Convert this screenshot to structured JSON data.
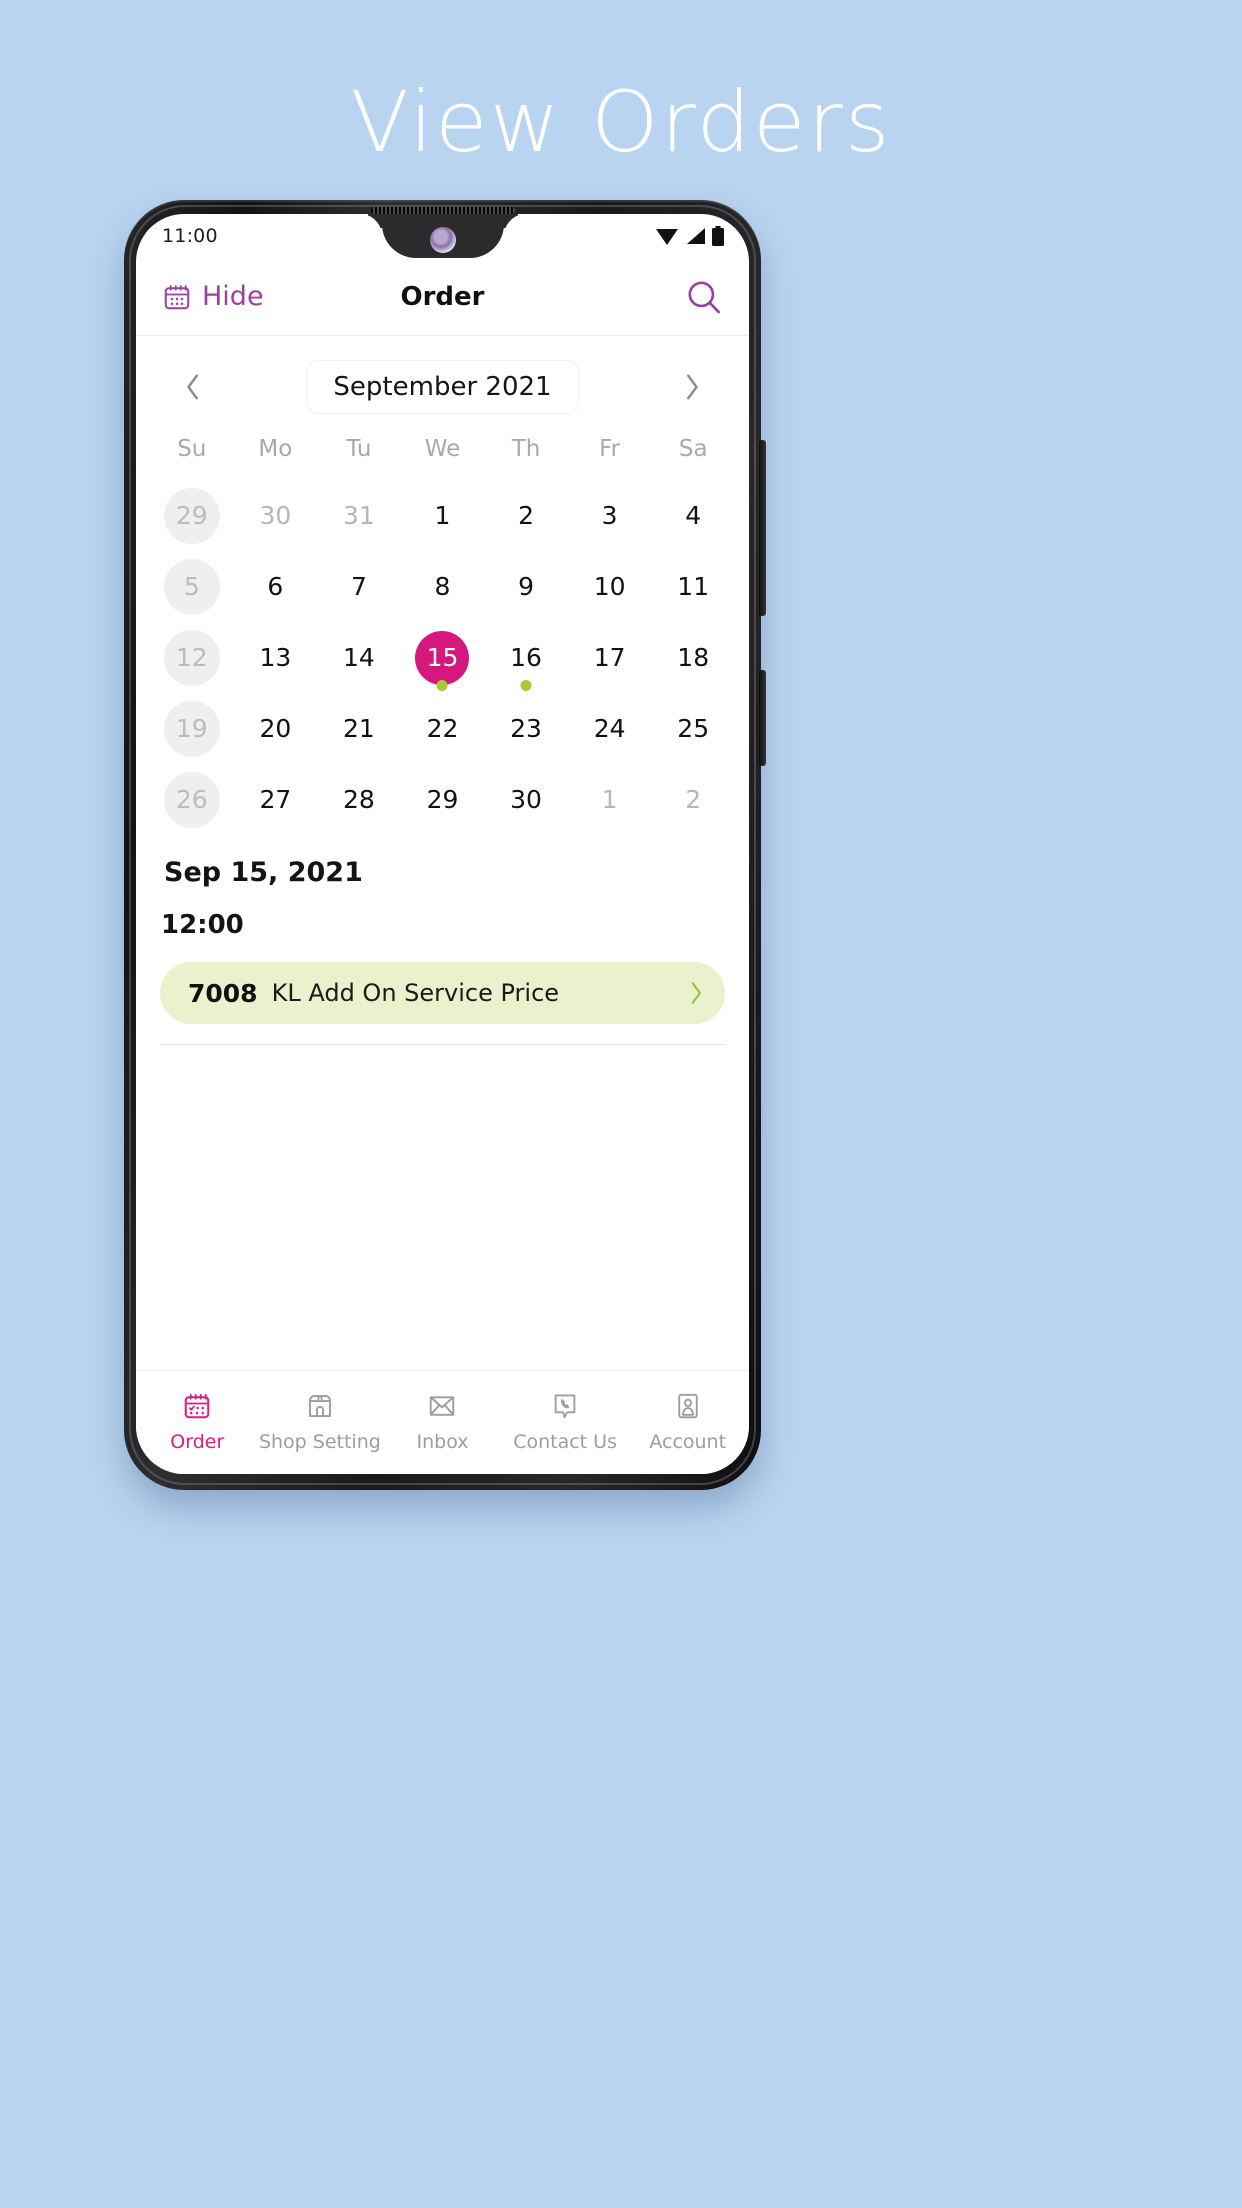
{
  "page": {
    "title": "View Orders",
    "background_color": "#b9d4f0"
  },
  "status_bar": {
    "time": "11:00",
    "icons": [
      "wifi-icon",
      "signal-icon",
      "battery-icon"
    ]
  },
  "app_header": {
    "hide_label": "Hide",
    "hide_icon": "calendar-icon",
    "title": "Order",
    "search_icon": "search-icon",
    "accent_color": "#9b3fa0"
  },
  "calendar": {
    "prev_icon": "chevron-left-icon",
    "next_icon": "chevron-right-icon",
    "month_label": "September 2021",
    "weekdays": [
      "Su",
      "Mo",
      "Tu",
      "We",
      "Th",
      "Fr",
      "Sa"
    ],
    "selected_color": "#d6187e",
    "event_dot_color": "#a4cc39",
    "days": [
      {
        "n": "29",
        "muted": true,
        "sunday": true,
        "selected": false,
        "dot": false
      },
      {
        "n": "30",
        "muted": true,
        "sunday": false,
        "selected": false,
        "dot": false
      },
      {
        "n": "31",
        "muted": true,
        "sunday": false,
        "selected": false,
        "dot": false
      },
      {
        "n": "1",
        "muted": false,
        "sunday": false,
        "selected": false,
        "dot": false
      },
      {
        "n": "2",
        "muted": false,
        "sunday": false,
        "selected": false,
        "dot": false
      },
      {
        "n": "3",
        "muted": false,
        "sunday": false,
        "selected": false,
        "dot": false
      },
      {
        "n": "4",
        "muted": false,
        "sunday": false,
        "selected": false,
        "dot": false
      },
      {
        "n": "5",
        "muted": false,
        "sunday": true,
        "selected": false,
        "dot": false
      },
      {
        "n": "6",
        "muted": false,
        "sunday": false,
        "selected": false,
        "dot": false
      },
      {
        "n": "7",
        "muted": false,
        "sunday": false,
        "selected": false,
        "dot": false
      },
      {
        "n": "8",
        "muted": false,
        "sunday": false,
        "selected": false,
        "dot": false
      },
      {
        "n": "9",
        "muted": false,
        "sunday": false,
        "selected": false,
        "dot": false
      },
      {
        "n": "10",
        "muted": false,
        "sunday": false,
        "selected": false,
        "dot": false
      },
      {
        "n": "11",
        "muted": false,
        "sunday": false,
        "selected": false,
        "dot": false
      },
      {
        "n": "12",
        "muted": false,
        "sunday": true,
        "selected": false,
        "dot": false
      },
      {
        "n": "13",
        "muted": false,
        "sunday": false,
        "selected": false,
        "dot": false
      },
      {
        "n": "14",
        "muted": false,
        "sunday": false,
        "selected": false,
        "dot": false
      },
      {
        "n": "15",
        "muted": false,
        "sunday": false,
        "selected": true,
        "dot": true
      },
      {
        "n": "16",
        "muted": false,
        "sunday": false,
        "selected": false,
        "dot": true
      },
      {
        "n": "17",
        "muted": false,
        "sunday": false,
        "selected": false,
        "dot": false
      },
      {
        "n": "18",
        "muted": false,
        "sunday": false,
        "selected": false,
        "dot": false
      },
      {
        "n": "19",
        "muted": false,
        "sunday": true,
        "selected": false,
        "dot": false
      },
      {
        "n": "20",
        "muted": false,
        "sunday": false,
        "selected": false,
        "dot": false
      },
      {
        "n": "21",
        "muted": false,
        "sunday": false,
        "selected": false,
        "dot": false
      },
      {
        "n": "22",
        "muted": false,
        "sunday": false,
        "selected": false,
        "dot": false
      },
      {
        "n": "23",
        "muted": false,
        "sunday": false,
        "selected": false,
        "dot": false
      },
      {
        "n": "24",
        "muted": false,
        "sunday": false,
        "selected": false,
        "dot": false
      },
      {
        "n": "25",
        "muted": false,
        "sunday": false,
        "selected": false,
        "dot": false
      },
      {
        "n": "26",
        "muted": false,
        "sunday": true,
        "selected": false,
        "dot": false
      },
      {
        "n": "27",
        "muted": false,
        "sunday": false,
        "selected": false,
        "dot": false
      },
      {
        "n": "28",
        "muted": false,
        "sunday": false,
        "selected": false,
        "dot": false
      },
      {
        "n": "29",
        "muted": false,
        "sunday": false,
        "selected": false,
        "dot": false
      },
      {
        "n": "30",
        "muted": false,
        "sunday": false,
        "selected": false,
        "dot": false
      },
      {
        "n": "1",
        "muted": true,
        "sunday": false,
        "selected": false,
        "dot": false
      },
      {
        "n": "2",
        "muted": true,
        "sunday": false,
        "selected": false,
        "dot": false
      }
    ]
  },
  "orders": {
    "selected_date": "Sep 15, 2021",
    "time_group": "12:00",
    "card_color": "#e9f2cd",
    "items": [
      {
        "id": "7008",
        "title": "KL  Add On Service Price",
        "chevron_icon": "chevron-right-icon"
      }
    ]
  },
  "bottom_nav": {
    "active_color": "#e3197f",
    "items": [
      {
        "label": "Order",
        "icon": "calendar-check-icon",
        "active": true
      },
      {
        "label": "Shop Setting",
        "icon": "shop-icon",
        "active": false
      },
      {
        "label": "Inbox",
        "icon": "envelope-icon",
        "active": false
      },
      {
        "label": "Contact Us",
        "icon": "phone-chat-icon",
        "active": false
      },
      {
        "label": "Account",
        "icon": "person-card-icon",
        "active": false
      }
    ]
  }
}
